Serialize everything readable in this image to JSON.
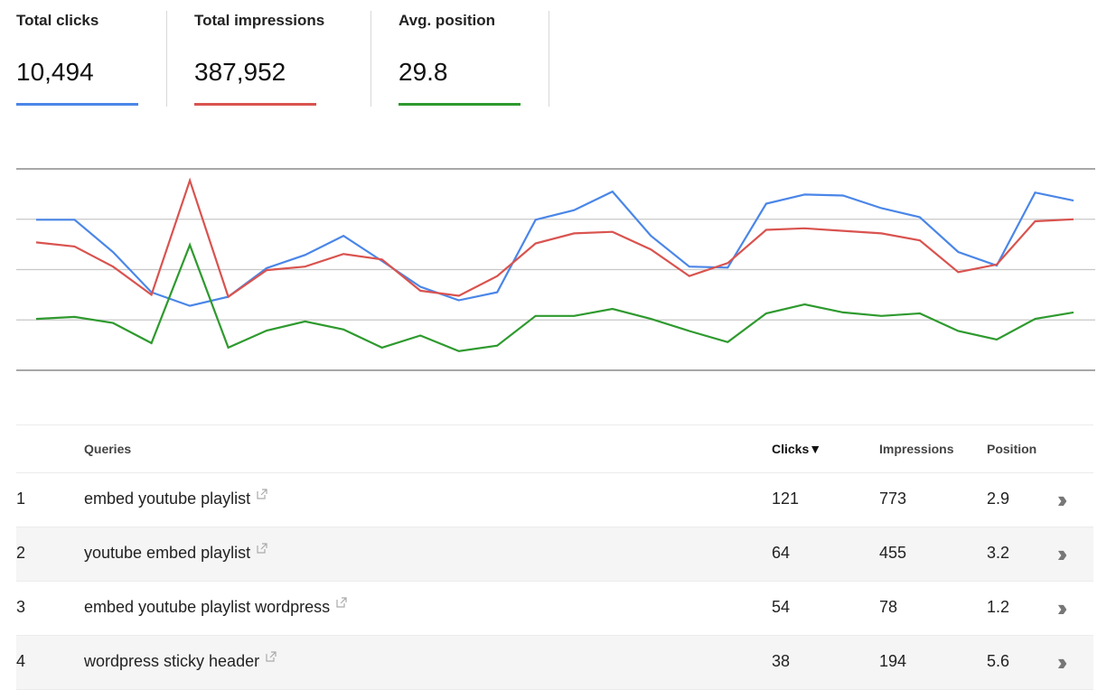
{
  "metrics": [
    {
      "label": "Total clicks",
      "value": "10,494",
      "color": "#4a86e8"
    },
    {
      "label": "Total impressions",
      "value": "387,952",
      "color": "#d9534f"
    },
    {
      "label": "Avg. position",
      "value": "29.8",
      "color": "#2e9a2e"
    }
  ],
  "chart_data": {
    "type": "line",
    "title": "",
    "xlabel": "",
    "ylabel": "",
    "grid": true,
    "legend": "top-left (metric tabs)",
    "x": [
      1,
      2,
      3,
      4,
      5,
      6,
      7,
      8,
      9,
      10,
      11,
      12,
      13,
      14,
      15,
      16,
      17,
      18,
      19,
      20,
      21,
      22,
      23,
      24,
      25,
      26,
      27,
      28
    ],
    "ylim": [
      0,
      4
    ],
    "gridlines": [
      0,
      1,
      2,
      3,
      4
    ],
    "series": [
      {
        "name": "Total clicks",
        "color": "#4a86e8",
        "values": [
          2.99,
          2.99,
          2.35,
          1.55,
          1.28,
          1.46,
          2.03,
          2.29,
          2.67,
          2.17,
          1.66,
          1.39,
          1.55,
          2.99,
          3.18,
          3.55,
          2.67,
          2.06,
          2.04,
          3.31,
          3.49,
          3.47,
          3.22,
          3.04,
          2.35,
          2.08,
          3.53,
          3.37
        ]
      },
      {
        "name": "Total impressions",
        "color": "#d9534f",
        "values": [
          2.54,
          2.46,
          2.06,
          1.5,
          3.77,
          1.46,
          1.99,
          2.06,
          2.31,
          2.2,
          1.58,
          1.48,
          1.87,
          2.52,
          2.72,
          2.75,
          2.4,
          1.87,
          2.13,
          2.79,
          2.82,
          2.77,
          2.72,
          2.58,
          1.95,
          2.1,
          2.96,
          3.0
        ]
      },
      {
        "name": "Avg. position",
        "color": "#2e9a2e",
        "values": [
          1.02,
          1.06,
          0.94,
          0.54,
          2.49,
          0.45,
          0.79,
          0.97,
          0.81,
          0.45,
          0.69,
          0.38,
          0.49,
          1.08,
          1.08,
          1.22,
          1.02,
          0.78,
          0.56,
          1.13,
          1.31,
          1.15,
          1.08,
          1.13,
          0.78,
          0.61,
          1.02,
          1.15
        ]
      }
    ]
  },
  "table": {
    "headers": {
      "queries": "Queries",
      "clicks": "Clicks▼",
      "impressions": "Impressions",
      "position": "Position"
    },
    "rows": [
      {
        "num": "1",
        "query": "embed youtube playlist",
        "clicks": "121",
        "impressions": "773",
        "position": "2.9"
      },
      {
        "num": "2",
        "query": "youtube embed playlist",
        "clicks": "64",
        "impressions": "455",
        "position": "3.2"
      },
      {
        "num": "3",
        "query": "embed youtube playlist wordpress",
        "clicks": "54",
        "impressions": "78",
        "position": "1.2"
      },
      {
        "num": "4",
        "query": "wordpress sticky header",
        "clicks": "38",
        "impressions": "194",
        "position": "5.6"
      }
    ],
    "row_action_icon": "double-chevron-right-icon",
    "query_link_icon": "external-link-icon"
  }
}
